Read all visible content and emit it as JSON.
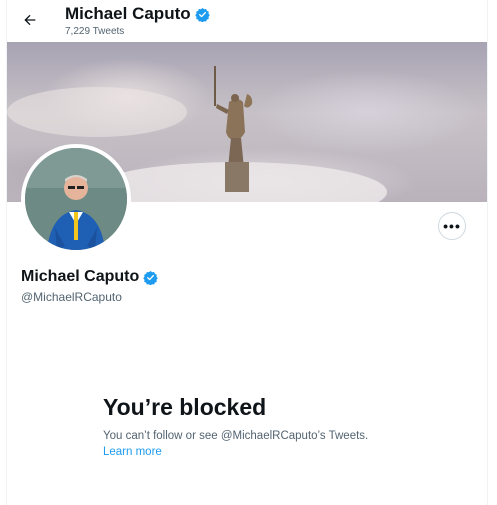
{
  "header": {
    "back_icon": "arrow-left-icon",
    "name": "Michael Caputo",
    "tweet_count": "7,229 Tweets"
  },
  "profile": {
    "display_name": "Michael Caputo",
    "handle": "@MichaelRCaputo",
    "verified_icon": "verified-badge-icon",
    "verified_color": "#1d9bf0",
    "more_icon": "more-horizontal-icon",
    "more_label": "•••"
  },
  "blocked": {
    "title": "You’re blocked",
    "message": "You can’t follow or see @MichaelRCaputo’s Tweets.",
    "learn_more": "Learn more",
    "link_color": "#1d9bf0"
  }
}
